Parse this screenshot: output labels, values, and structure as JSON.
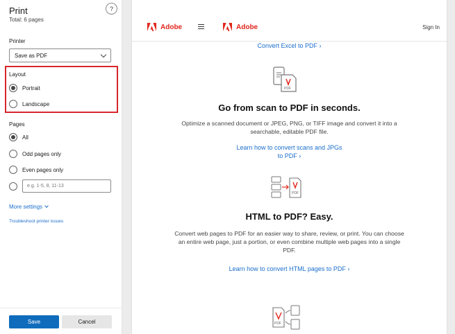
{
  "dialog": {
    "title": "Print",
    "subtitle": "Total: 6 pages",
    "help_label": "?",
    "printer_label": "Printer",
    "printer_value": "Save as PDF",
    "layout_label": "Layout",
    "layout_options": [
      {
        "label": "Portrait",
        "selected": true
      },
      {
        "label": "Landscape",
        "selected": false
      }
    ],
    "pages_label": "Pages",
    "pages_options": [
      {
        "label": "All",
        "selected": true
      },
      {
        "label": "Odd pages only",
        "selected": false
      },
      {
        "label": "Even pages only",
        "selected": false
      }
    ],
    "custom_range_placeholder": "e.g. 1-5, 8, 11-13",
    "more_settings": "More settings",
    "troubleshoot": "Troubleshoot printer issues",
    "save_label": "Save",
    "cancel_label": "Cancel",
    "highlight_color": "#d7262b",
    "accent_color": "#0f6cbd"
  },
  "preview": {
    "header": {
      "brand_left": "Adobe",
      "brand_right": "Adobe",
      "sign_in": "Sign In",
      "brand_color": "#e1251b"
    },
    "convert_excel_link": "Convert Excel to PDF ›",
    "scan_section": {
      "icon": "phone-to-pdf-icon",
      "heading": "Go from scan to PDF in seconds.",
      "body_line1": "Optimize a scanned document or JPEG, PNG, or TIFF image and convert it into a",
      "body_line2": "searchable, editable PDF file.",
      "link_line1": "Learn how to convert scans and JPGs",
      "link_line2": "to PDF ›"
    },
    "html_section": {
      "icon": "html-to-pdf-icon",
      "heading": "HTML to PDF? Easy.",
      "body_line1": "Convert web pages to PDF for an easier way to share, review, or print. You can choose",
      "body_line2": "an entire web page, just a portion, or even combine multiple web pages into a single",
      "body_line3": "PDF.",
      "link": "Learn how to convert HTML pages to PDF ›"
    },
    "bottom_icon": "pdf-convert-icon"
  }
}
